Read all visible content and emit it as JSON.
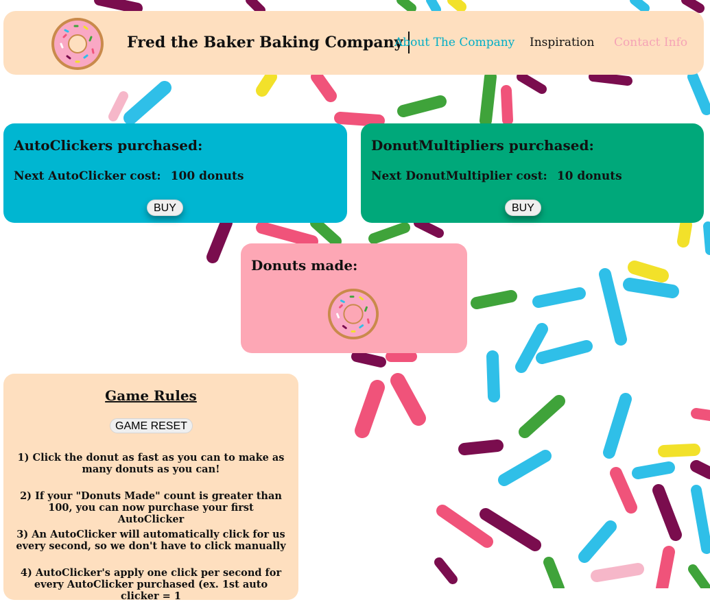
{
  "header": {
    "company_name": "Fred the Baker Baking Company",
    "nav": {
      "about": "About The Company",
      "inspiration": "Inspiration",
      "contact": "Contact Info"
    }
  },
  "autoclicker": {
    "heading": "AutoClickers purchased:",
    "cost_label": "Next AutoClicker cost:",
    "cost_value": "100 donuts",
    "buy_label": "BUY"
  },
  "multiplier": {
    "heading": "DonutMultipliers purchased:",
    "cost_label": "Next DonutMultiplier cost:",
    "cost_value": "10 donuts",
    "buy_label": "BUY"
  },
  "donuts": {
    "heading": "Donuts made:"
  },
  "rules": {
    "title": "Game Rules",
    "reset_label": "GAME RESET",
    "items": [
      "1) Click the donut as fast as you can to make as many donuts as you can!",
      "2) If your \"Donuts Made\" count is greater than 100, you can now purchase your first AutoClicker",
      "3) An AutoClicker will automatically click for us every second, so we don't have to click manually",
      "4) AutoClicker's apply one click per second for every AutoClicker purchased (ex. 1st auto clicker = 1"
    ]
  },
  "colors": {
    "header_bg": "#fedfbf",
    "autoclicker_bg": "#00b6d1",
    "multiplier_bg": "#00a87a",
    "donuts_bg": "#fda7b5",
    "rules_bg": "#fedfbf",
    "nav_about": "#00aec6",
    "nav_contact": "#f5a3b6"
  },
  "icons": {
    "logo": "donut-icon",
    "clicker": "donut-icon",
    "background": "sprinkles"
  }
}
